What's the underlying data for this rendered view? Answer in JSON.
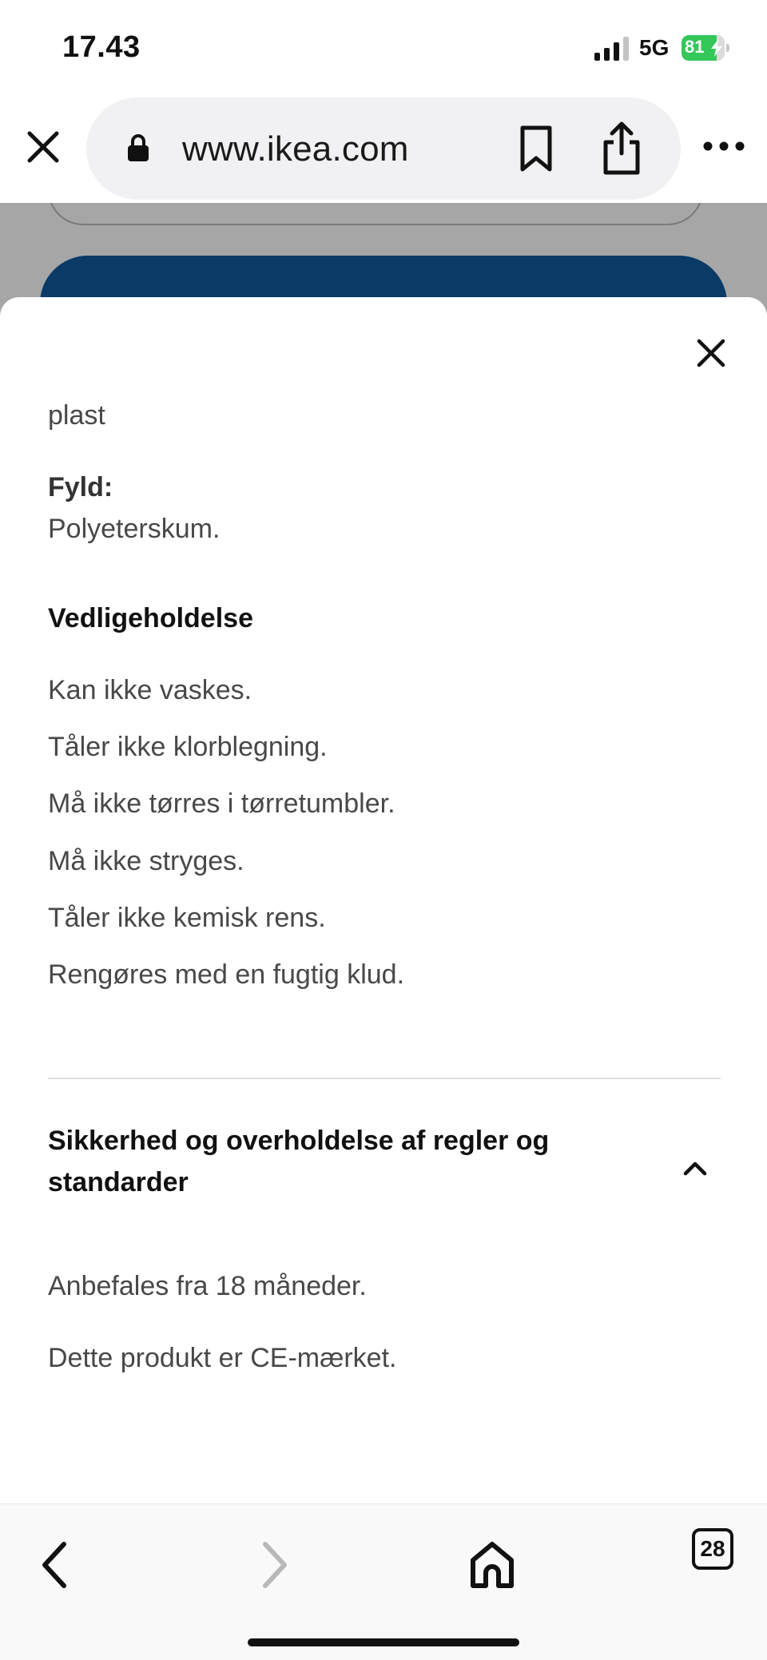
{
  "status_bar": {
    "time": "17.43",
    "network": "5G",
    "battery_percent": "81",
    "battery_level": 0.81,
    "colors": {
      "battery": "#34c759"
    }
  },
  "browser": {
    "url": "www.ikea.com",
    "icons": {
      "close": "close-icon",
      "lock": "lock-icon",
      "bookmark": "bookmark-icon",
      "share": "share-icon",
      "more": "more-icon"
    }
  },
  "sheet": {
    "material_tail": "plast",
    "filling_label": "Fyld:",
    "filling_value": "Polyeterskum.",
    "care_title": "Vedligeholdelse",
    "care_items": [
      "Kan ikke vaskes.",
      "Tåler ikke klorblegning.",
      "Må ikke tørres i tørretumbler.",
      "Må ikke stryges.",
      "Tåler ikke kemisk rens.",
      "Rengøres med en fugtig klud."
    ],
    "safety_title_line1": "Sikkerhed og overholdelse af regler og",
    "safety_title_line2": "standarder",
    "safety_items": [
      "Anbefales fra 18 måneder.",
      "Dette produkt er CE-mærket."
    ]
  },
  "bottom_nav": {
    "tabs_count": "28",
    "icons": {
      "back": "chevron-left-icon",
      "forward": "chevron-right-icon",
      "home": "home-icon",
      "tabs": "tabs-icon"
    }
  },
  "colors": {
    "backdrop_button": "#0a3a66",
    "text": "#484848"
  }
}
